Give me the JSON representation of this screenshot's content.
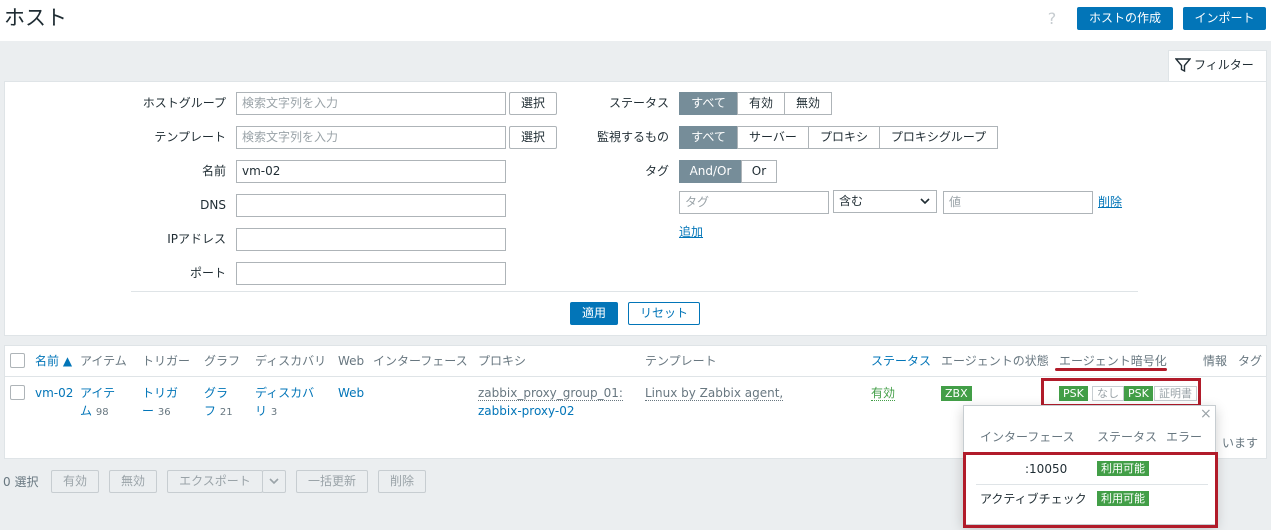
{
  "header": {
    "title": "ホスト",
    "help": "?",
    "create_host": "ホストの作成",
    "import": "インポート"
  },
  "filter": {
    "tab_label": "フィルター",
    "host_group_label": "ホストグループ",
    "host_group_placeholder": "検索文字列を入力",
    "template_label": "テンプレート",
    "template_placeholder": "検索文字列を入力",
    "select_label": "選択",
    "name_label": "名前",
    "name_value": "vm-02",
    "dns_label": "DNS",
    "ip_label": "IPアドレス",
    "port_label": "ポート",
    "status_label": "ステータス",
    "status_options": [
      "すべて",
      "有効",
      "無効"
    ],
    "monitored_by_label": "監視するもの",
    "monitored_by_options": [
      "すべて",
      "サーバー",
      "プロキシ",
      "プロキシグループ"
    ],
    "tags_label": "タグ",
    "tag_operator_options": [
      "And/Or",
      "Or"
    ],
    "tag_placeholder": "タグ",
    "tag_condition": "含む",
    "tag_value_placeholder": "値",
    "remove_label": "削除",
    "add_label": "追加",
    "apply": "適用",
    "reset": "リセット"
  },
  "table": {
    "columns": [
      "名前 ▲",
      "アイテム",
      "トリガー",
      "グラフ",
      "ディスカバリ",
      "Web",
      "インターフェース",
      "プロキシ",
      "テンプレート",
      "ステータス",
      "エージェントの状態",
      "エージェント暗号化",
      "情報",
      "タグ"
    ],
    "row": {
      "name": "vm-02",
      "items_label": "アイテ",
      "items_label2": "ム",
      "items_count": "98",
      "triggers_label": "トリガ",
      "triggers_label2": "ー",
      "triggers_count": "36",
      "graphs_label": "グラ",
      "graphs_label2": "フ",
      "graphs_count": "21",
      "discovery_label": "ディスカバ",
      "discovery_label2": "リ",
      "discovery_count": "3",
      "web": "Web",
      "proxy_group": "zabbix_proxy_group_01:",
      "proxy": "zabbix-proxy-02",
      "template": "Linux by Zabbix agent,",
      "status": "有効",
      "agent": "ZBX",
      "encryption": [
        "PSK",
        "なし",
        "PSK",
        "証明書"
      ]
    },
    "footer_partial": "います"
  },
  "popup": {
    "close": "×",
    "columns": [
      "インターフェース",
      "ステータス",
      "エラー"
    ],
    "rows": [
      {
        "interface": ":10050",
        "status": "利用可能"
      },
      {
        "interface": "アクティブチェック",
        "status": "利用可能"
      }
    ]
  },
  "actions": {
    "selected": "0 選択",
    "enable": "有効",
    "disable": "無効",
    "export": "エクスポート",
    "mass_update": "一括更新",
    "delete": "削除"
  },
  "colors": {
    "accent": "#0275b8",
    "ok": "#429e47",
    "highlight": "#b11b2a"
  }
}
